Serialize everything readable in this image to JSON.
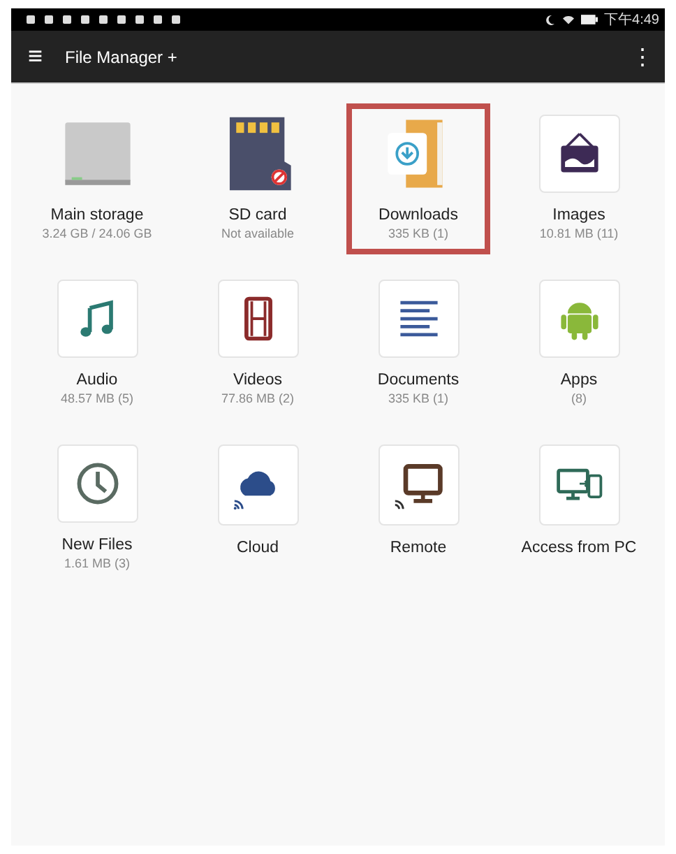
{
  "status_bar": {
    "time": "下午4:49"
  },
  "app_bar": {
    "menu_icon": "≡",
    "title": "File Manager +",
    "overflow_icon": "⋮"
  },
  "items": [
    {
      "kind": "storage",
      "label": "Main storage",
      "detail": "3.24 GB / 24.06 GB",
      "selected": false
    },
    {
      "kind": "sdcard",
      "label": "SD card",
      "detail": "Not available",
      "selected": false
    },
    {
      "kind": "downloads",
      "label": "Downloads",
      "detail": "335 KB (1)",
      "selected": true
    },
    {
      "kind": "images",
      "label": "Images",
      "detail": "10.81 MB (11)",
      "selected": false
    },
    {
      "kind": "audio",
      "label": "Audio",
      "detail": "48.57 MB (5)",
      "selected": false
    },
    {
      "kind": "videos",
      "label": "Videos",
      "detail": "77.86 MB (2)",
      "selected": false
    },
    {
      "kind": "documents",
      "label": "Documents",
      "detail": "335 KB (1)",
      "selected": false
    },
    {
      "kind": "apps",
      "label": "Apps",
      "detail": "(8)",
      "selected": false
    },
    {
      "kind": "recent",
      "label": "New Files",
      "detail": "1.61 MB (3)",
      "selected": false
    },
    {
      "kind": "cloud",
      "label": "Cloud",
      "selected": false
    },
    {
      "kind": "remote",
      "label": "Remote",
      "selected": false
    },
    {
      "kind": "pc",
      "label": "Access from PC",
      "selected": false
    }
  ]
}
